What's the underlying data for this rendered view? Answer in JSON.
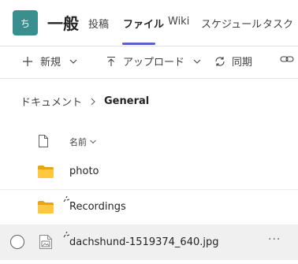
{
  "header": {
    "avatar_initial": "ち",
    "channel_name": "一般",
    "tabs": [
      {
        "label": "投稿"
      },
      {
        "label": "ファイル"
      },
      {
        "label": "Wiki"
      },
      {
        "label": "スケジュール"
      },
      {
        "label": "タスク"
      }
    ],
    "active_tab": "ファイル",
    "accent_color": "#5b5fc7",
    "avatar_color": "#3b8e8e"
  },
  "command_bar": {
    "new_label": "新規",
    "upload_label": "アップロード",
    "sync_label": "同期"
  },
  "breadcrumb": {
    "root": "ドキュメント",
    "current": "General"
  },
  "file_list": {
    "column_name_label": "名前",
    "items": [
      {
        "name": "photo",
        "type": "folder-icon"
      },
      {
        "name": "Recordings",
        "type": "folder-icon"
      },
      {
        "name": "dachshund-1519374_640.jpg",
        "type": "image-file-icon",
        "more": "···"
      }
    ]
  }
}
